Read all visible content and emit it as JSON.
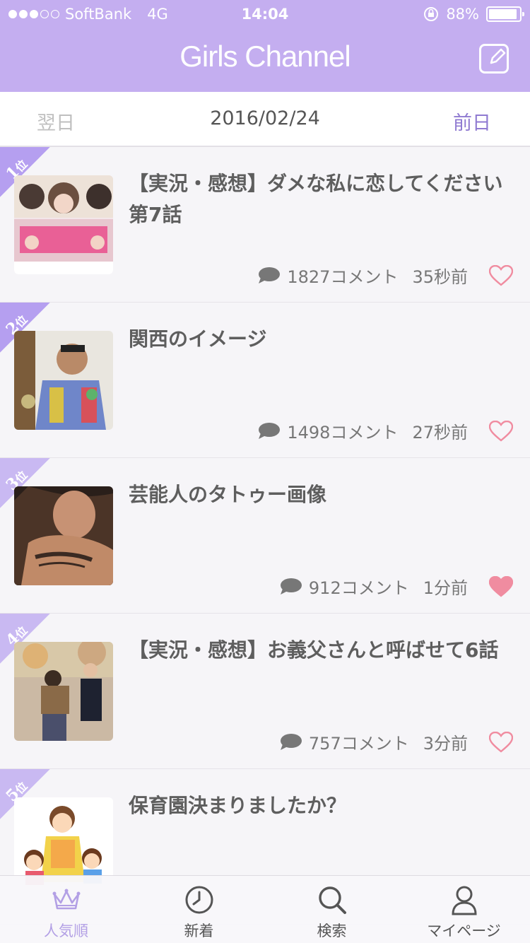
{
  "status": {
    "carrier": "SoftBank",
    "network": "4G",
    "time": "14:04",
    "battery": "88%"
  },
  "header": {
    "title": "Girls Channel",
    "compose_icon": "compose-icon"
  },
  "datebar": {
    "next": "翌日",
    "date": "2016/02/24",
    "prev": "前日"
  },
  "items": [
    {
      "rank": "1",
      "rank_suffix": "位",
      "title": "【実況・感想】ダメな私に恋してください　第7話",
      "comments": "1827コメント",
      "time": "35秒前",
      "liked": false,
      "thumb_color": "#e7c7cf"
    },
    {
      "rank": "2",
      "rank_suffix": "位",
      "title": "関西のイメージ",
      "comments": "1498コメント",
      "time": "27秒前",
      "liked": false,
      "thumb_color": "#c7b87e"
    },
    {
      "rank": "3",
      "rank_suffix": "位",
      "title": "芸能人のタトゥー画像",
      "comments": "912コメント",
      "time": "1分前",
      "liked": true,
      "thumb_color": "#8a6650"
    },
    {
      "rank": "4",
      "rank_suffix": "位",
      "title": "【実況・感想】お義父さんと呼ばせて6話",
      "comments": "757コメント",
      "time": "3分前",
      "liked": false,
      "thumb_color": "#a7907a"
    },
    {
      "rank": "5",
      "rank_suffix": "位",
      "title": "保育園決まりましたか？",
      "comments": "",
      "time": "",
      "liked": false,
      "thumb_color": "#ffffff"
    }
  ],
  "tabs": [
    {
      "label": "人気順",
      "icon": "crown-icon"
    },
    {
      "label": "新着",
      "icon": "clock-icon"
    },
    {
      "label": "検索",
      "icon": "search-icon"
    },
    {
      "label": "マイページ",
      "icon": "user-icon"
    }
  ],
  "colors": {
    "header": "#c4aef0",
    "rank_ribbon": "#b59ff0",
    "rank_ribbon_light": "#c9b9f2",
    "accent": "#8f7ad1",
    "heart": "#f08ca0"
  }
}
